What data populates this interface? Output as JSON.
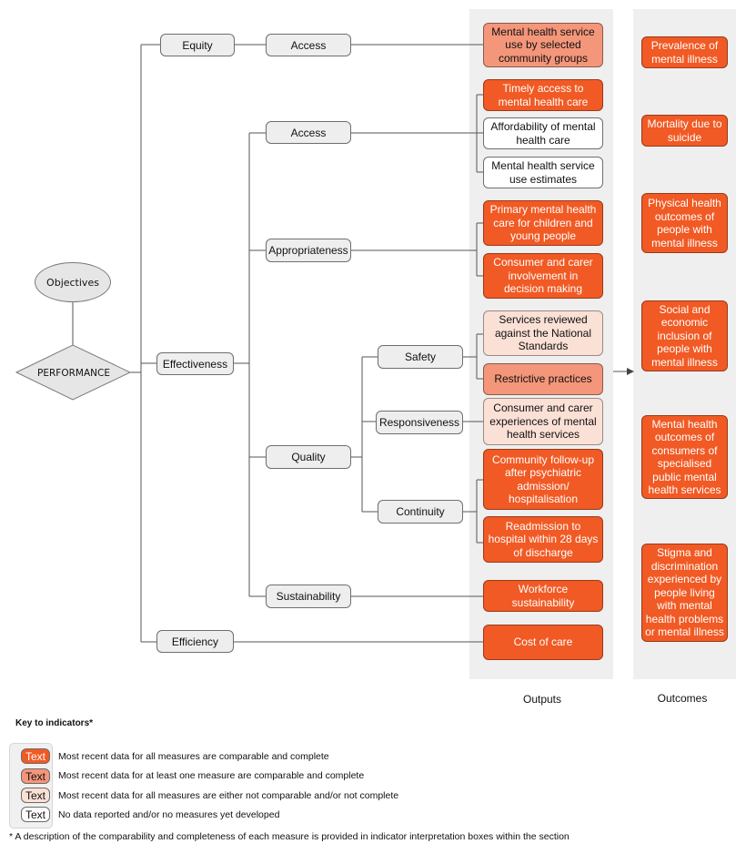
{
  "diagram": {
    "root": {
      "objectives": "Objectives",
      "performance": "PERFORMANCE"
    },
    "level1": [
      {
        "id": "equity",
        "label": "Equity"
      },
      {
        "id": "effectiveness",
        "label": "Effectiveness"
      },
      {
        "id": "efficiency",
        "label": "Efficiency"
      }
    ],
    "level2": [
      {
        "id": "equity-access",
        "label": "Access",
        "parent": "equity"
      },
      {
        "id": "eff-access",
        "label": "Access",
        "parent": "effectiveness"
      },
      {
        "id": "appropriateness",
        "label": "Appropriateness",
        "parent": "effectiveness"
      },
      {
        "id": "quality",
        "label": "Quality",
        "parent": "effectiveness"
      },
      {
        "id": "sustainability",
        "label": "Sustainability",
        "parent": "effectiveness"
      }
    ],
    "level3": [
      {
        "id": "safety",
        "label": "Safety",
        "parent": "quality"
      },
      {
        "id": "responsiveness",
        "label": "Responsiveness",
        "parent": "quality"
      },
      {
        "id": "continuity",
        "label": "Continuity",
        "parent": "quality"
      }
    ],
    "outputs": [
      {
        "label": "Mental health service use by selected community groups",
        "status": 2,
        "parent": "equity-access"
      },
      {
        "label": "Timely access to mental health care",
        "status": 1,
        "parent": "eff-access"
      },
      {
        "label": "Affordability of mental health care",
        "status": 4,
        "parent": "eff-access"
      },
      {
        "label": "Mental health service use estimates",
        "status": 4,
        "parent": "eff-access"
      },
      {
        "label": "Primary mental health care for children and young people",
        "status": 1,
        "parent": "appropriateness"
      },
      {
        "label": "Consumer and carer involvement in decision making",
        "status": 1,
        "parent": "appropriateness"
      },
      {
        "label": "Services reviewed against the National Standards",
        "status": 3,
        "parent": "safety"
      },
      {
        "label": "Restrictive practices",
        "status": 2,
        "parent": "safety"
      },
      {
        "label": "Consumer and carer experiences of mental health services",
        "status": 3,
        "parent": "responsiveness"
      },
      {
        "label": "Community follow-up after psychiatric admission/ hospitalisation",
        "status": 1,
        "parent": "continuity"
      },
      {
        "label": "Readmission to hospital within 28 days of discharge",
        "status": 1,
        "parent": "continuity"
      },
      {
        "label": "Workforce sustainability",
        "status": 1,
        "parent": "sustainability"
      },
      {
        "label": "Cost of care",
        "status": 1,
        "parent": "efficiency"
      }
    ],
    "outcomes": [
      {
        "label": "Prevalence of mental illness",
        "status": 1
      },
      {
        "label": "Mortality due to suicide",
        "status": 1
      },
      {
        "label": "Physical health outcomes of people with mental illness",
        "status": 1
      },
      {
        "label": "Social and economic inclusion of people with mental illness",
        "status": 1
      },
      {
        "label": "Mental health outcomes of consumers of specialised public mental health services",
        "status": 1
      },
      {
        "label": "Stigma and discrimination experienced by people living with mental health problems or mental illness",
        "status": 1
      }
    ],
    "column_labels": {
      "outputs": "Outputs",
      "outcomes": "Outcomes"
    }
  },
  "key": {
    "title": "Key to indicators*",
    "swatch_text": "Text",
    "items": [
      {
        "status": 1,
        "label": "Most recent data for all measures are comparable and complete"
      },
      {
        "status": 2,
        "label": "Most recent data for at least one measure are comparable and complete"
      },
      {
        "status": 3,
        "label": "Most recent data for all measures are either not comparable and/or not complete"
      },
      {
        "status": 4,
        "label": "No data reported and/or no measures yet developed"
      }
    ],
    "footnote": "* A description of the comparability and completeness of each measure is provided in indicator interpretation boxes within the section"
  },
  "colors": {
    "status_1": "#f15a24",
    "status_2": "#f4967a",
    "status_3": "#fbe0d6",
    "status_4": "#ffffff",
    "panel": "#efefef",
    "node": "#eeeeee"
  }
}
